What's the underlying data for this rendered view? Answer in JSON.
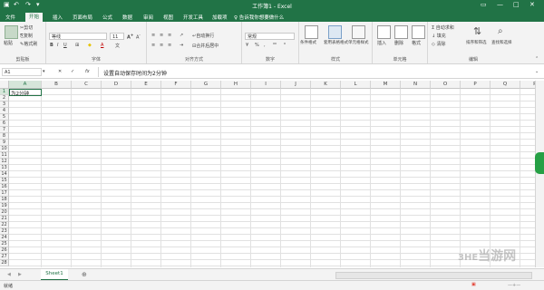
{
  "app": {
    "title": "工作簿1 - Excel",
    "accent": "#217346"
  },
  "tabs": [
    "文件",
    "开始",
    "插入",
    "页面布局",
    "公式",
    "数据",
    "审阅",
    "视图",
    "开发工具",
    "加载项",
    "团队"
  ],
  "tell_me": "告诉我你想要做什么",
  "ribbon": {
    "clipboard": {
      "paste": "粘贴",
      "cut": "剪切",
      "copy": "复制",
      "format_painter": "格式刷",
      "label": "剪贴板"
    },
    "font": {
      "name": "等线",
      "size": "11",
      "label": "字体"
    },
    "alignment": {
      "wrap": "自动换行",
      "merge": "合并后居中",
      "label": "对齐方式"
    },
    "number": {
      "format": "常规",
      "label": "数字"
    },
    "styles": {
      "conditional": "条件格式",
      "table": "套用表格格式",
      "cell_styles": "单元格样式",
      "label": "样式"
    },
    "cells": {
      "insert": "插入",
      "delete": "删除",
      "format": "格式",
      "label": "单元格"
    },
    "editing": {
      "autosum": "自动求和",
      "fill": "填充",
      "clear": "清除",
      "sort": "排序和筛选",
      "find": "查找和选择",
      "label": "编辑"
    }
  },
  "formula_bar": {
    "name_box": "A1",
    "fx": "fx",
    "content": "设置自动保存时间为2分钟"
  },
  "grid": {
    "columns": [
      "A",
      "B",
      "C",
      "D",
      "E",
      "F",
      "G",
      "H",
      "I",
      "J",
      "K",
      "L",
      "M",
      "N",
      "O",
      "P",
      "Q",
      "R"
    ],
    "rows": [
      "1",
      "2",
      "3",
      "4",
      "5",
      "6",
      "7",
      "8",
      "9",
      "10",
      "11",
      "12",
      "13",
      "14",
      "15",
      "16",
      "17",
      "18",
      "19",
      "20",
      "21",
      "22",
      "23",
      "24",
      "25",
      "26",
      "27",
      "28"
    ],
    "a1_value": "为2分钟"
  },
  "sheets": {
    "active": "Sheet1",
    "add": "⊕"
  },
  "status": {
    "ready": "就绪"
  },
  "watermark": "当游网"
}
